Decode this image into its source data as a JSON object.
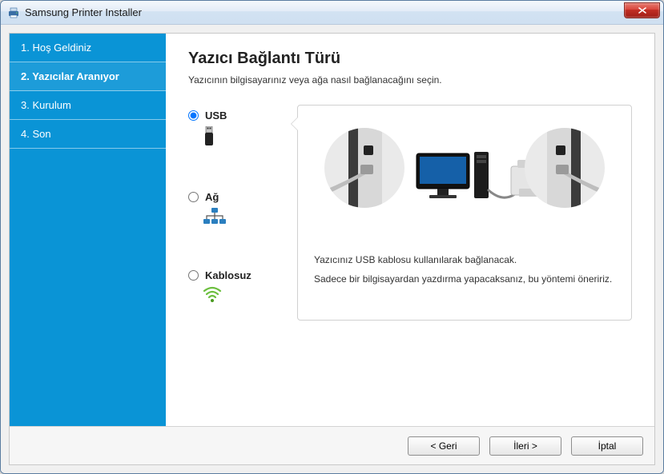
{
  "window": {
    "title": "Samsung Printer Installer"
  },
  "sidebar": {
    "steps": [
      {
        "label": "1. Hoş Geldiniz"
      },
      {
        "label": "2. Yazıcılar Aranıyor"
      },
      {
        "label": "3. Kurulum"
      },
      {
        "label": "4. Son"
      }
    ],
    "active_index": 1
  },
  "main": {
    "heading": "Yazıcı Bağlantı Türü",
    "subtitle": "Yazıcının bilgisayarınız veya ağa nasıl bağlanacağını seçin."
  },
  "options": {
    "usb": {
      "label": "USB",
      "selected": true
    },
    "network": {
      "label": "Ağ",
      "selected": false
    },
    "wireless": {
      "label": "Kablosuz",
      "selected": false
    }
  },
  "preview": {
    "line1": "Yazıcınız USB kablosu kullanılarak bağlanacak.",
    "line2": "Sadece bir bilgisayardan yazdırma yapacaksanız, bu yöntemi öneririz."
  },
  "footer": {
    "back": "< Geri",
    "next": "İleri >",
    "cancel": "İptal"
  }
}
